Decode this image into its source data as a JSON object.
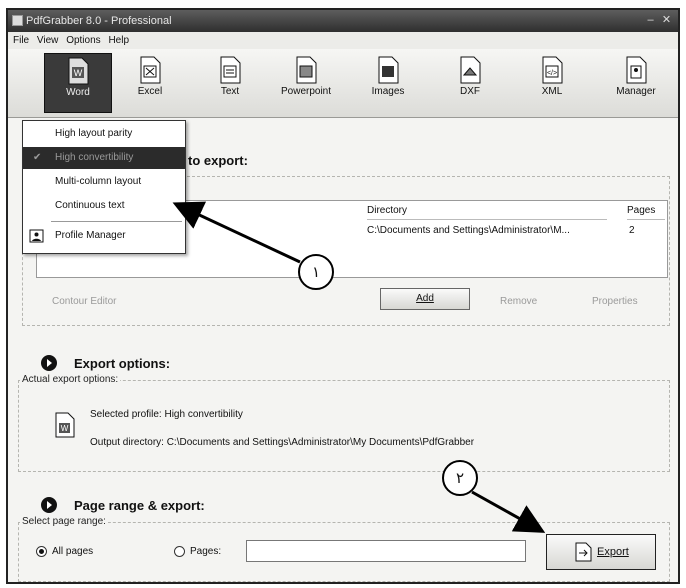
{
  "window": {
    "title": "PdfGrabber 8.0 - Professional"
  },
  "menubar": [
    "File",
    "View",
    "Options",
    "Help"
  ],
  "toolbar": [
    {
      "label": "Word",
      "icon": "word-doc-icon",
      "active": true
    },
    {
      "label": "Excel",
      "icon": "excel-doc-icon"
    },
    {
      "label": "Text",
      "icon": "text-doc-icon"
    },
    {
      "label": "Powerpoint",
      "icon": "powerpoint-doc-icon"
    },
    {
      "label": "Images",
      "icon": "images-doc-icon"
    },
    {
      "label": "DXF",
      "icon": "dxf-doc-icon"
    },
    {
      "label": "XML",
      "icon": "xml-doc-icon"
    },
    {
      "label": "Manager",
      "icon": "manager-doc-icon"
    }
  ],
  "word_menu": {
    "items": [
      "High layout parity",
      "High convertibility",
      "Multi-column layout",
      "Continuous text"
    ],
    "selected": "High convertibility",
    "profile_manager": "Profile Manager"
  },
  "files_section": {
    "heading_visible": "to export:",
    "table": {
      "columns": [
        "Directory",
        "Pages"
      ],
      "rows": [
        {
          "directory": "C:\\Documents and Settings\\Administrator\\M...",
          "pages": "2"
        }
      ]
    },
    "buttons": {
      "contour_editor": "Contour Editor",
      "add": "Add",
      "remove": "Remove",
      "properties": "Properties"
    }
  },
  "export_options": {
    "heading": "Export options:",
    "group_label": "Actual export options:",
    "selected_profile": "Selected profile: High convertibility",
    "output_directory": "Output directory: C:\\Documents and Settings\\Administrator\\My Documents\\PdfGrabber"
  },
  "page_range": {
    "heading": "Page range & export:",
    "group_label": "Select page range:",
    "all_pages": "All pages",
    "pages": "Pages:",
    "pages_value": "",
    "selected_option": "All pages",
    "export_button": "Export"
  },
  "callouts": [
    "١",
    "٢"
  ]
}
